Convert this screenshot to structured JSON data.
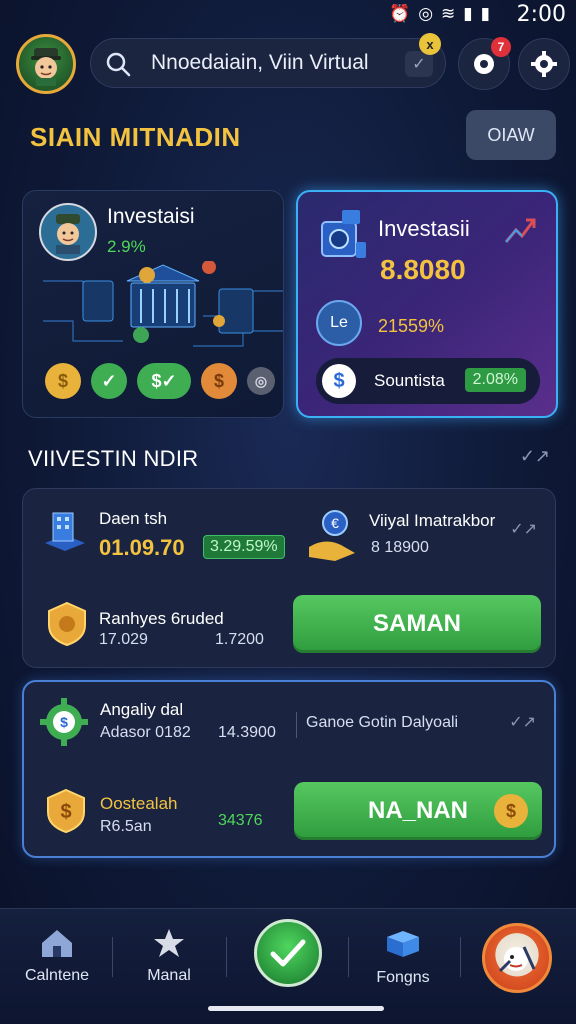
{
  "status": {
    "time": "2:00"
  },
  "header": {
    "search_text": "Nnoedaiain, Viin Virtual",
    "search_badge": "x",
    "notif_badge": "7"
  },
  "title": {
    "text": "SIAIN MITNADIN",
    "button_label": "OIAW"
  },
  "card_left": {
    "title": "Investaisi",
    "value": "2.9%"
  },
  "card_right": {
    "title": "Investasii",
    "value": "8.8080",
    "circle_label": "Le",
    "amount": "21559%",
    "pill_text": "Sountista",
    "pill_badge": "2.08%"
  },
  "section": {
    "title": "VIIVESTIN NDIR"
  },
  "panel1": {
    "item1_title": "Daen tsh",
    "item1_value": "01.09.70",
    "item1_badge": "3.29.59%",
    "item2_title": "Viiyal Imatrakbor",
    "item2_value": "8 18900",
    "item3_title": "Ranhyes 6ruded",
    "item3_sub1": "17.029",
    "item3_sub2": "1.7200",
    "button_label": "SAMAN"
  },
  "panel2": {
    "item1_title": "Angaliy dal",
    "item1_sub": "Adasor 0182",
    "item1_value": "14.3900",
    "item2_title": "Ganoe Gotin Dalyoali",
    "item3_title": "Oostealah",
    "item3_sub": "R6.5an",
    "item3_value": "34376",
    "button_label": "NA_NAN"
  },
  "nav": {
    "item1": "Calntene",
    "item2": "Manal",
    "item4": "Fongns"
  }
}
